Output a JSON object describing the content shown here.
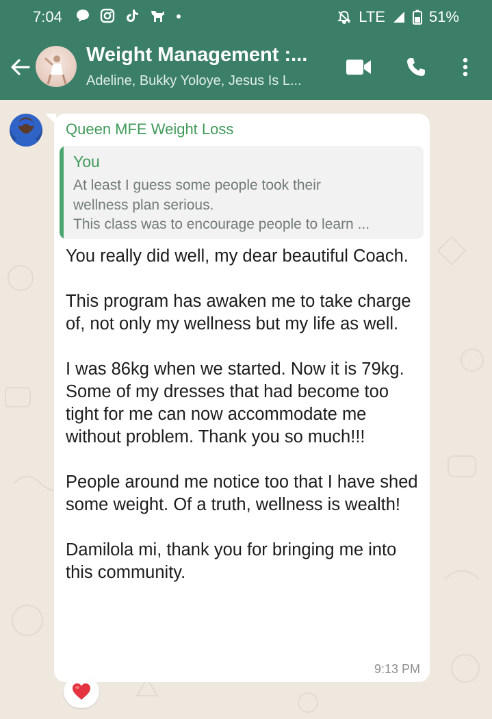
{
  "status_bar": {
    "time": "7:04",
    "network": "LTE",
    "battery": "51%",
    "icons_left": [
      "chat-bubble-icon",
      "instagram-icon",
      "tiktok-icon",
      "dog-icon",
      "dot-icon"
    ],
    "icons_right": [
      "bell-off-icon",
      "signal-icon",
      "battery-icon"
    ]
  },
  "app_bar": {
    "title": "Weight Management :...",
    "subtitle": "Adeline, Bukky Yoloye, Jesus Is L...",
    "actions": [
      "video-call-icon",
      "phone-icon",
      "more-vert-icon"
    ]
  },
  "message": {
    "sender": "Queen MFE Weight Loss",
    "quote": {
      "author": "You",
      "lines": [
        "At least I guess some people took their",
        "wellness plan serious.",
        "This class was to encourage people to learn ..."
      ]
    },
    "paragraphs": [
      "You really did well, my dear beautiful Coach.",
      "This program has awaken me to take charge of, not only my wellness but my life as well.",
      "I was 86kg when we started. Now it is 79kg. Some of my dresses that had become too tight for me can now accommodate me without problem. Thank you so much!!!",
      "People around me notice too that I have shed some weight. Of a truth, wellness is wealth!",
      "Damilola mi, thank you for bringing me into this community."
    ],
    "time": "9:13 PM",
    "reaction": "❤️"
  },
  "colors": {
    "header": "#3b7f69",
    "sender_name": "#3f9a59",
    "quote_bar": "#4ca56e",
    "bubble": "#ffffff",
    "wallpaper": "#eee8df"
  }
}
